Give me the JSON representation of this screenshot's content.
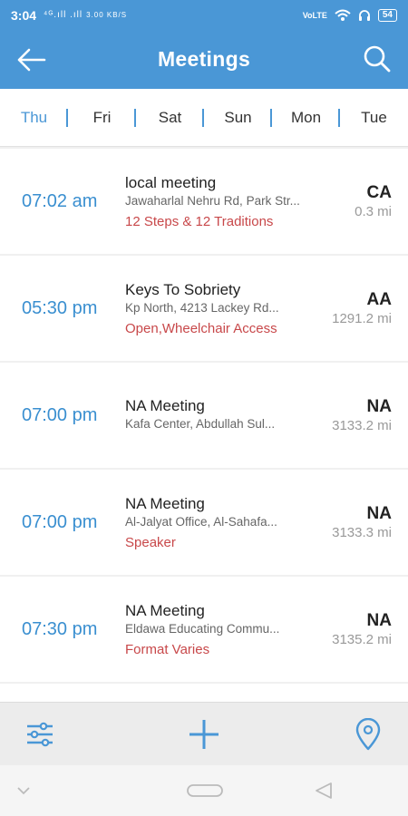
{
  "status_bar": {
    "time": "3:04",
    "signal_text": "⁴ᴳ.ıll .ıll",
    "data_speed": "3.00 KB/S",
    "network": "VoLTE",
    "battery": "54"
  },
  "header": {
    "title": "Meetings",
    "back_icon": "arrow-left-icon",
    "search_icon": "search-icon"
  },
  "days": [
    {
      "label": "Thu",
      "active": true
    },
    {
      "label": "Fri",
      "active": false
    },
    {
      "label": "Sat",
      "active": false
    },
    {
      "label": "Sun",
      "active": false
    },
    {
      "label": "Mon",
      "active": false
    },
    {
      "label": "Tue",
      "active": false
    }
  ],
  "meetings": [
    {
      "time": "07:02 am",
      "name": "local meeting",
      "address": "Jawaharlal Nehru Rd, Park Str...",
      "types": "12 Steps & 12 Traditions",
      "fellowship": "CA",
      "distance": "0.3 mi"
    },
    {
      "time": "05:30 pm",
      "name": "Keys To Sobriety",
      "address": "Kp North, 4213 Lackey Rd...",
      "types": "Open,Wheelchair Access",
      "fellowship": "AA",
      "distance": "1291.2 mi"
    },
    {
      "time": "07:00 pm",
      "name": "NA Meeting",
      "address": "Kafa Center, Abdullah Sul...",
      "types": "",
      "fellowship": "NA",
      "distance": "3133.2 mi"
    },
    {
      "time": "07:00 pm",
      "name": "NA Meeting",
      "address": "Al-Jalyat Office, Al-Sahafa...",
      "types": "Speaker",
      "fellowship": "NA",
      "distance": "3133.3 mi"
    },
    {
      "time": "07:30 pm",
      "name": "NA Meeting",
      "address": "Eldawa Educating Commu...",
      "types": "Format Varies",
      "fellowship": "NA",
      "distance": "3135.2 mi"
    }
  ],
  "toolbar": {
    "filter_icon": "sliders-icon",
    "add_icon": "plus-icon",
    "location_icon": "location-pin-icon"
  },
  "colors": {
    "primary": "#4a97d6",
    "time_text": "#3a8fd0",
    "types_text": "#c8484a"
  }
}
